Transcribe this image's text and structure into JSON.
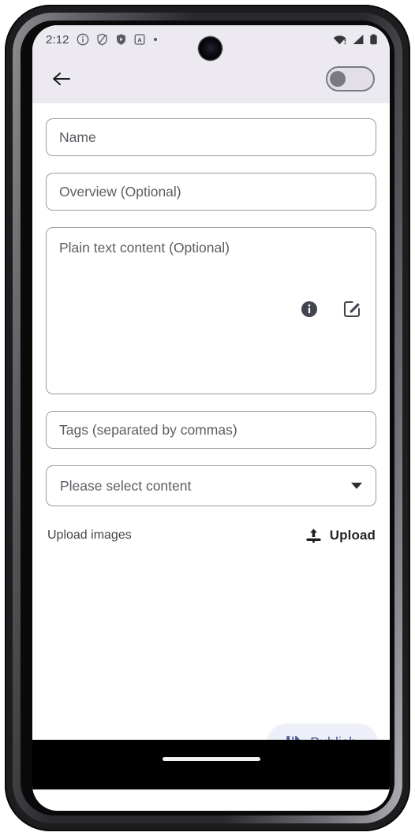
{
  "status_bar": {
    "clock": "2:12",
    "left_icons": [
      "info-circle-icon",
      "shield-slash-icon",
      "shield-filled-icon",
      "app-badge-icon",
      "dot-icon"
    ],
    "right_icons": [
      "wifi-alert-icon",
      "cellular-signal-icon",
      "battery-full-icon"
    ]
  },
  "app_bar": {
    "back_icon": "back-arrow-icon",
    "toggle": {
      "name": "mode-toggle",
      "state": "off"
    }
  },
  "form": {
    "name": {
      "value": "",
      "placeholder": "Name"
    },
    "overview": {
      "value": "",
      "placeholder": "Overview (Optional)"
    },
    "plain_text": {
      "value": "",
      "placeholder": "Plain text content (Optional)",
      "info_icon": "info-icon",
      "edit_icon": "edit-square-icon"
    },
    "tags": {
      "value": "",
      "placeholder": "Tags (separated by commas)"
    },
    "content_select": {
      "value": "Please select content",
      "caret_icon": "chevron-down-icon"
    }
  },
  "upload": {
    "label": "Upload images",
    "button_label": "Upload",
    "button_icon": "upload-icon"
  },
  "publish": {
    "label": "Publish",
    "icon": "save-icon"
  },
  "colors": {
    "app_bar_bg": "#eceaf0",
    "content_bg": "#ffffff",
    "field_border": "#9b9ba2",
    "placeholder": "#5c5c64",
    "publish_bg": "#eef0f9",
    "publish_fg": "#4c5f99",
    "nav_bg": "#000000"
  }
}
